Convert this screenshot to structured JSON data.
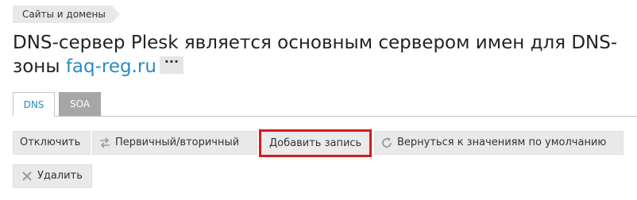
{
  "breadcrumb": {
    "items": [
      {
        "label": "Сайты и домены"
      }
    ]
  },
  "page": {
    "title_prefix": "DNS-сервер Plesk является основным сервером имен для DNS-зоны ",
    "domain": "faq-reg.ru",
    "more_label": "···"
  },
  "tabs": [
    {
      "label": "DNS",
      "active": true
    },
    {
      "label": "SOA",
      "active": false
    }
  ],
  "toolbar": {
    "disable_label": "Отключить",
    "primary_secondary_label": "Первичный/вторичный",
    "add_record_label": "Добавить запись",
    "revert_defaults_label": "Вернуться к значениям по умолчанию",
    "delete_label": "Удалить"
  },
  "icons": {
    "primary_secondary": "swap-arrows-icon",
    "revert_defaults": "refresh-icon",
    "delete": "close-x-icon"
  },
  "colors": {
    "link": "#2b8ac6",
    "highlight": "#d51b1b",
    "tab_inactive": "#a6a6a6",
    "button_bg": "#e9e9e9"
  }
}
